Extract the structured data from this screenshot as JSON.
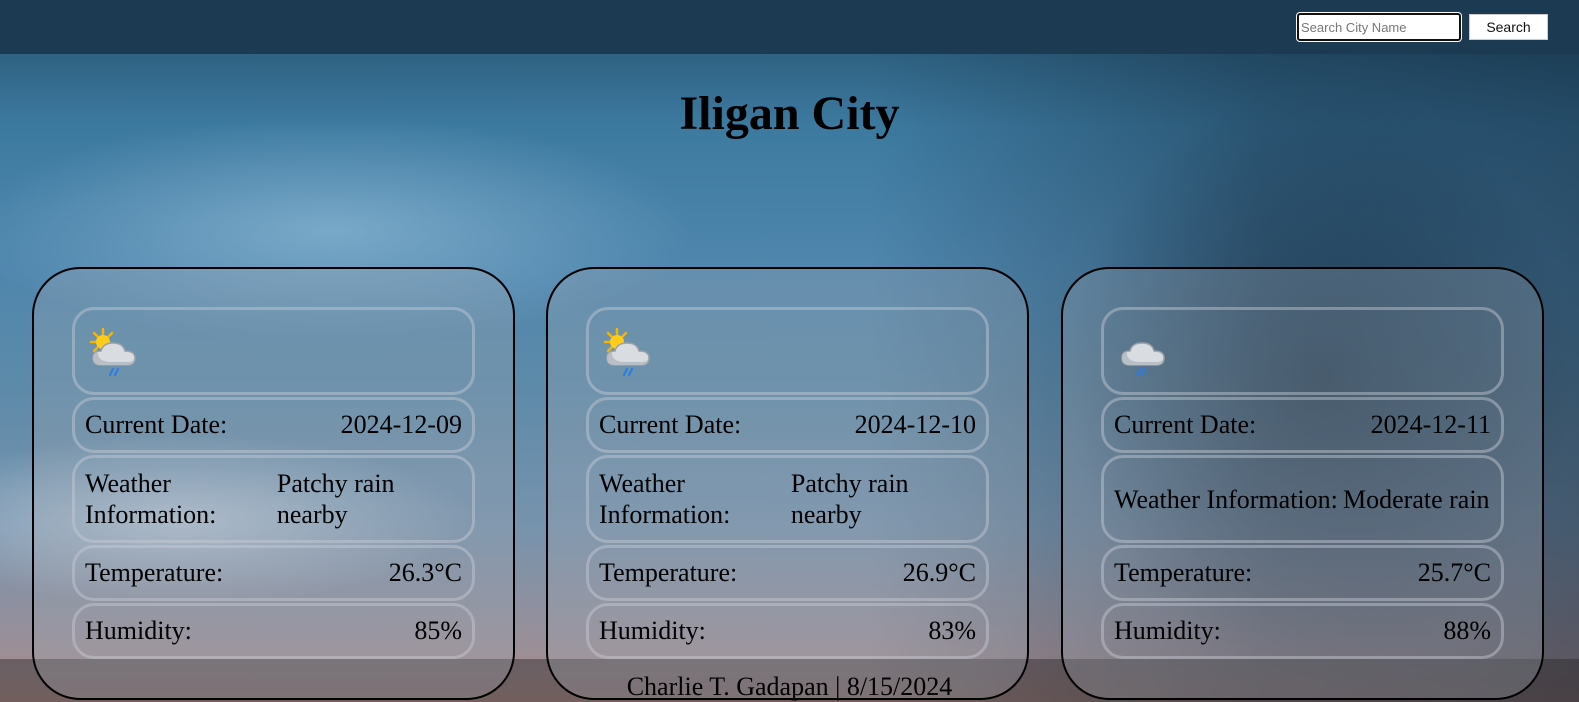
{
  "search": {
    "placeholder": "Search City Name",
    "button_label": "Search"
  },
  "city": {
    "name": "Iligan City"
  },
  "labels": {
    "date": "Current Date:",
    "weather": "Weather Information:",
    "temperature": "Temperature:",
    "humidity": "Humidity:"
  },
  "forecast": [
    {
      "icon": "partly-cloudy-rain-icon",
      "date": "2024-12-09",
      "weather": "Patchy rain nearby",
      "temperature": "26.3°C",
      "humidity": "85%"
    },
    {
      "icon": "partly-cloudy-rain-icon",
      "date": "2024-12-10",
      "weather": "Patchy rain nearby",
      "temperature": "26.9°C",
      "humidity": "83%"
    },
    {
      "icon": "cloud-rain-icon",
      "date": "2024-12-11",
      "weather": "Moderate rain",
      "temperature": "25.7°C",
      "humidity": "88%"
    }
  ],
  "footer": {
    "text": "Charlie T. Gadapan | 8/15/2024"
  },
  "colors": {
    "topbar": "#1c3b52",
    "card_border": "#000000",
    "tile_border": "#c8cdd4"
  }
}
